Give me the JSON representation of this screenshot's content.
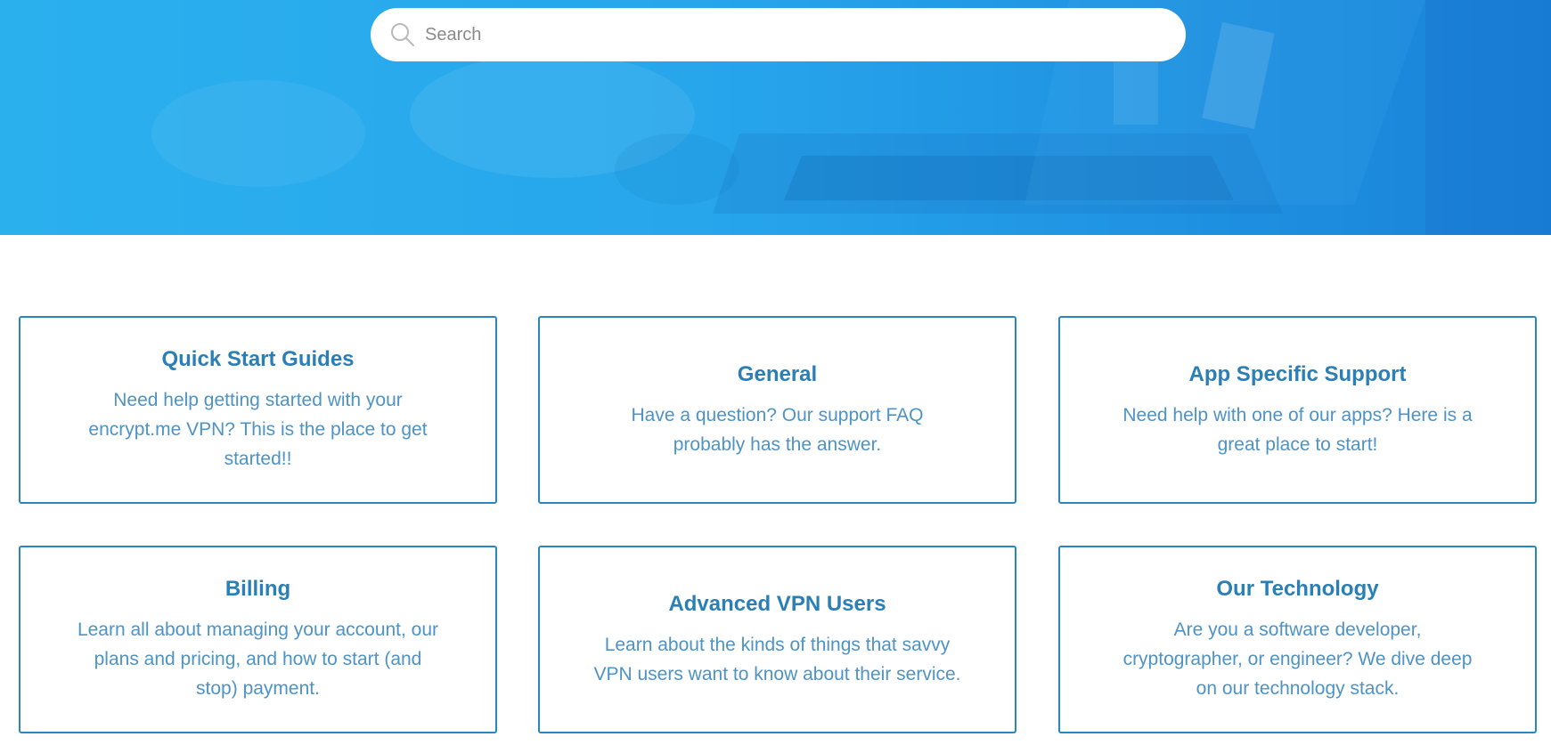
{
  "colors": {
    "hero_blue": "#27a6ec",
    "card_border": "#2a86bf",
    "card_title": "#2a7fb6",
    "card_text": "#4e93c5"
  },
  "search": {
    "placeholder": "Search",
    "icon": "search-icon"
  },
  "categories": [
    {
      "title": "Quick Start Guides",
      "description": "Need help getting started with your encrypt.me VPN? This is the place to get started!!"
    },
    {
      "title": "General",
      "description": "Have a question? Our support FAQ probably has the answer."
    },
    {
      "title": "App Specific Support",
      "description": "Need help with one of our apps? Here is a great place to start!"
    },
    {
      "title": "Billing",
      "description": "Learn all about managing your account, our plans and pricing, and how to start (and stop) payment."
    },
    {
      "title": "Advanced VPN Users",
      "description": "Learn about the kinds of things that savvy VPN users want to know about their service."
    },
    {
      "title": "Our Technology",
      "description": "Are you a software developer, cryptographer, or engineer? We dive deep on our technology stack."
    }
  ]
}
